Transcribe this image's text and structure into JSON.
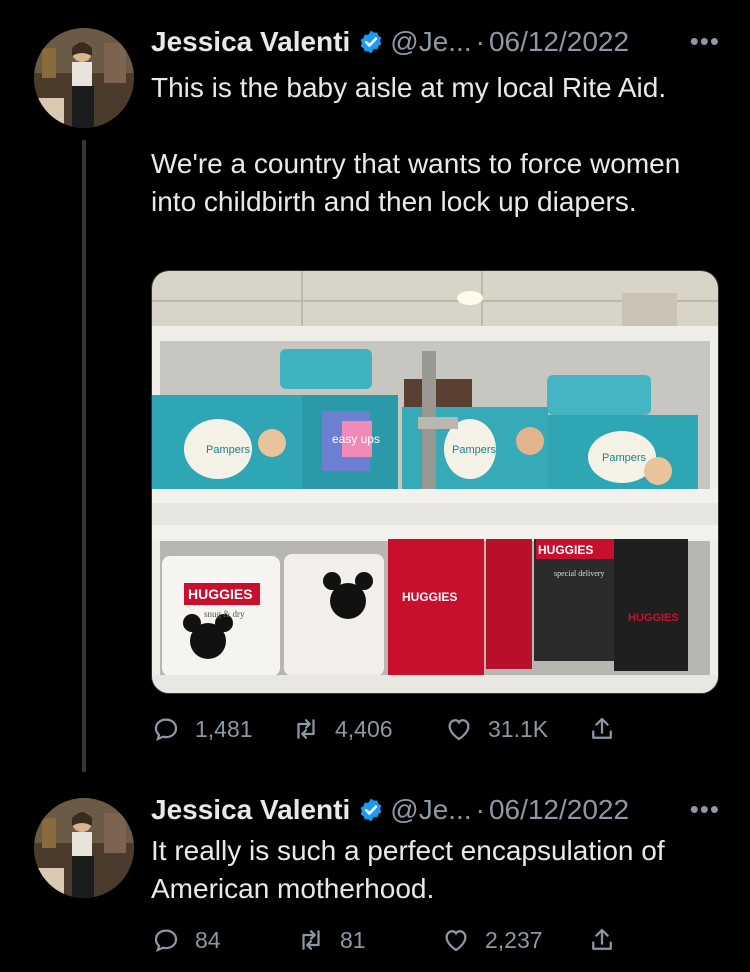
{
  "tweets": [
    {
      "author": {
        "name": "Jessica Valenti",
        "handle": "@Je...",
        "verified": true
      },
      "date": "06/12/2022",
      "text": "This is the baby aisle at my local Rite Aid.\n\nWe're a country that wants to force women into childbirth and then lock up diapers.",
      "stats": {
        "replies": "1,481",
        "retweets": "4,406",
        "likes": "31.1K"
      },
      "media": {
        "brand_labels": [
          "Pampers",
          "easy ups",
          "Pampers",
          "Pampers",
          "HUGGIES",
          "snug & dry",
          "HUGGIES",
          "HUGGIES",
          "special delivery",
          "HUGGIES"
        ]
      }
    },
    {
      "author": {
        "name": "Jessica Valenti",
        "handle": "@Je...",
        "verified": true
      },
      "date": "06/12/2022",
      "text": "It really is such a perfect encapsulation of American motherhood.",
      "stats": {
        "replies": "84",
        "retweets": "81",
        "likes": "2,237"
      }
    }
  ],
  "ui": {
    "separator": "·",
    "more": "•••"
  },
  "colors": {
    "background": "#000000",
    "text": "#e7e9ea",
    "secondary": "#8b98a5",
    "verified": "#1d9bf0",
    "pampers_teal": "#2fa6b3",
    "huggies_red": "#c8102e"
  }
}
